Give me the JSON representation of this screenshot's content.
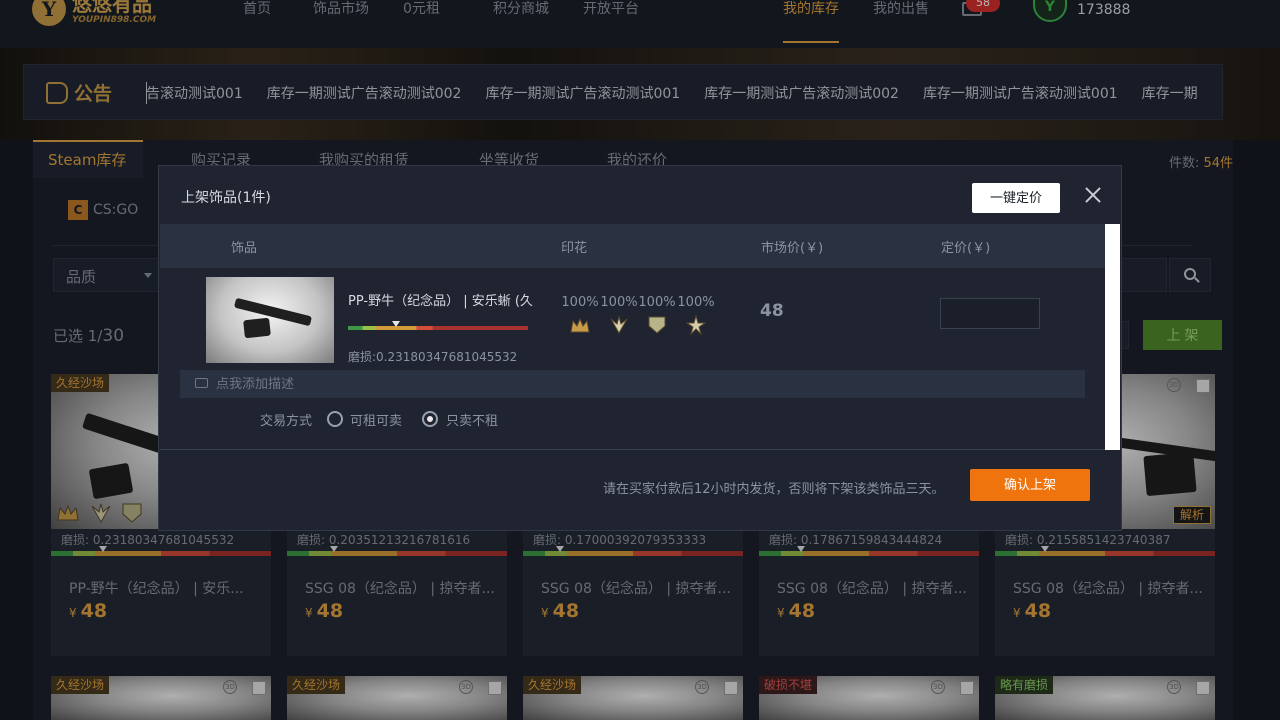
{
  "nav": {
    "logo_text": "悠悠有品",
    "logo_sub": "YOUPIN898.COM",
    "items": [
      {
        "label": "首页"
      },
      {
        "label": "饰品市场"
      },
      {
        "label": "0元租"
      },
      {
        "label": "积分商城"
      },
      {
        "label": "开放平台"
      }
    ],
    "right_items": [
      {
        "label": "我的库存",
        "active": true
      },
      {
        "label": "我的出售",
        "active": false
      }
    ],
    "mail_badge": "58",
    "avatar_icon": "user-avatar-icon",
    "points": "173888"
  },
  "announcement": {
    "label": "公告",
    "items": [
      "告滚动测试001",
      "库存一期测试广告滚动测试002",
      "库存一期测试广告滚动测试001",
      "库存一期测试广告滚动测试002",
      "库存一期测试广告滚动测试001",
      "库存一期"
    ]
  },
  "inventory": {
    "tabs": [
      {
        "label": "Steam库存",
        "active": true
      },
      {
        "label": "购买记录"
      },
      {
        "label": "我购买的租赁"
      },
      {
        "label": "坐等收货"
      },
      {
        "label": "我的还价"
      }
    ],
    "count_label": "件数: ",
    "count_value": "54件",
    "game_label": "CS:GO",
    "quality_label": "品质",
    "selected_prefix": "已选 1/",
    "selected_max": "30",
    "shelf_button": "上 架"
  },
  "cards": [
    {
      "tag": "久经沙场",
      "tag_color": "#e2a243",
      "wear": "磨损: 0.23180347681045532",
      "name": "PP-野牛（纪念品） | 安乐...",
      "currency": "¥",
      "price": "48"
    },
    {
      "tag": "",
      "tag_color": "#e2a243",
      "wear": "磨损: 0.20351213216781616",
      "name": "SSG 08（纪念品） | 掠夺者...",
      "currency": "¥",
      "price": "48"
    },
    {
      "tag": "",
      "tag_color": "#e2a243",
      "wear": "磨损: 0.17000392079353333",
      "name": "SSG 08（纪念品） | 掠夺者...",
      "currency": "¥",
      "price": "48"
    },
    {
      "tag": "",
      "tag_color": "#e2a243",
      "wear": "磨损: 0.17867159843444824",
      "name": "SSG 08（纪念品） | 掠夺者...",
      "currency": "¥",
      "price": "48"
    },
    {
      "tag": "",
      "tag_color": "#e2a243",
      "wear": "磨损: 0.2155851423740387",
      "name": "SSG 08（纪念品） | 掠夺者...",
      "currency": "¥",
      "price": "48",
      "action": "解析"
    }
  ],
  "cards_row2": [
    {
      "tag": "久经沙场",
      "tag_color": "#e2a243"
    },
    {
      "tag": "久经沙场",
      "tag_color": "#e2a243"
    },
    {
      "tag": "久经沙场",
      "tag_color": "#e2a243"
    },
    {
      "tag": "破损不堪",
      "tag_color": "#e25656"
    },
    {
      "tag": "略有磨损",
      "tag_color": "#8fd16e"
    }
  ],
  "modal": {
    "title": "上架饰品(1件)",
    "auto_price_button": "一键定价",
    "columns": {
      "item": "饰品",
      "stickers": "印花",
      "market_price": "市场价(￥)",
      "set_price": "定价(￥)"
    },
    "row": {
      "name": "PP-野牛（纪念品） | 安乐蜥 (久",
      "wear": "磨损:0.23180347681045532",
      "stickers": [
        {
          "pct": "100%",
          "icon": "crown-sticker-icon"
        },
        {
          "pct": "100%",
          "icon": "wings-sticker-icon"
        },
        {
          "pct": "100%",
          "icon": "shield-sticker-icon"
        },
        {
          "pct": "100%",
          "icon": "star-sticker-icon"
        }
      ],
      "market_price": "48",
      "price_value": ""
    },
    "desc_placeholder": "点我添加描述",
    "trade_label": "交易方式",
    "trade_options": [
      {
        "label": "可租可卖",
        "checked": false
      },
      {
        "label": "只卖不租",
        "checked": true
      }
    ],
    "footer_note": "请在买家付款后12小时内发货，否则将下架该类饰品三天。",
    "confirm_button": "确认上架"
  }
}
